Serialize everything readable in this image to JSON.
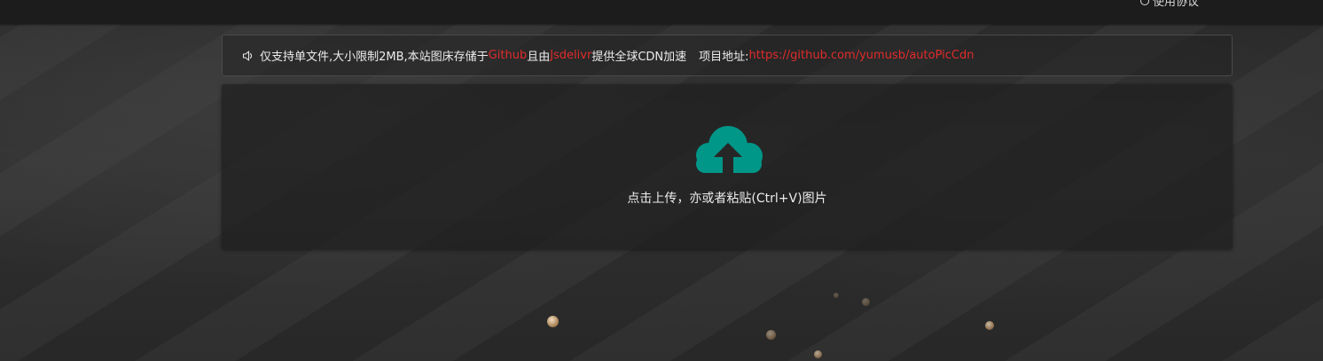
{
  "header": {
    "agreement_label": "使用协议"
  },
  "notice": {
    "icon": "speaker-icon",
    "text_1": "仅支持单文件,大小限制2MB,本站图床存储于",
    "github_label": "Github",
    "text_2": "且由",
    "jsdelivr_label": "Jsdelivr",
    "text_3": "提供全球CDN加速",
    "project_label": "项目地址:",
    "project_url": "https://github.com/yumusb/autoPicCdn"
  },
  "upload": {
    "icon": "cloud-upload-icon",
    "text": "点击上传，亦或者粘贴(Ctrl+V)图片"
  },
  "colors": {
    "accent": "#009688",
    "link_red": "#e02b2b",
    "topbar": "#1c1c1c"
  }
}
